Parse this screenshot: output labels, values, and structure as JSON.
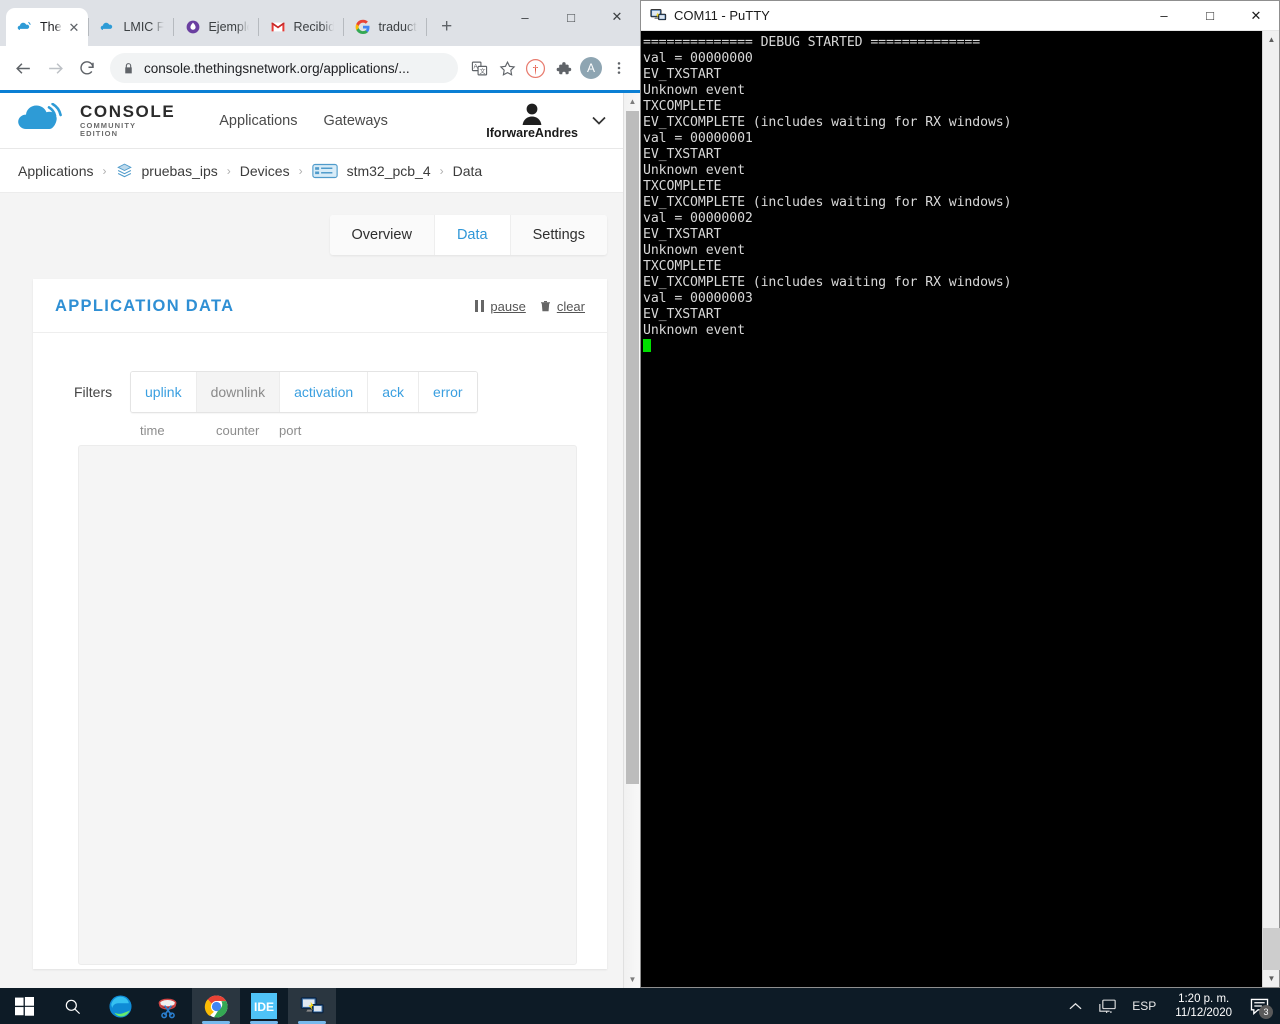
{
  "browser": {
    "tabs": [
      {
        "title": "The",
        "favicon": "ttn-cloud-icon",
        "active": true
      },
      {
        "title": "LMIC FO",
        "favicon": "ttn-cloud-icon",
        "active": false
      },
      {
        "title": "Ejemplo",
        "favicon": "firefox-droplet-icon",
        "active": false
      },
      {
        "title": "Recibid",
        "favicon": "gmail-icon",
        "active": false
      },
      {
        "title": "traduct",
        "favicon": "google-icon",
        "active": false
      }
    ],
    "new_tab_label": "+",
    "window_controls": {
      "minimize": "–",
      "maximize": "□",
      "close": "✕"
    },
    "toolbar": {
      "back_label": "←",
      "forward_label": "→",
      "reload_label": "⟳",
      "url": "console.thethingsnetwork.org/applications/...",
      "url_host": "console.thethingsnetwork.org",
      "url_path": "/applications/...",
      "lock_icon": "lock-icon",
      "translate_icon": "translate-icon",
      "bookmark_icon": "star-icon",
      "pdf_icon": "adobe-acrobat-icon",
      "extensions_icon": "puzzle-piece-icon",
      "profile_initial": "A",
      "menu_icon": "three-dots-icon"
    }
  },
  "ttn": {
    "logo": {
      "title": "CONSOLE",
      "subtitle_line1": "COMMUNITY",
      "subtitle_line2": "EDITION"
    },
    "nav": [
      {
        "label": "Applications"
      },
      {
        "label": "Gateways"
      }
    ],
    "user": {
      "name": "IforwareAndres",
      "chevron": "⌄"
    },
    "breadcrumb": [
      {
        "label": "Applications",
        "icon": null
      },
      {
        "label": "pruebas_ips",
        "icon": "layers-icon"
      },
      {
        "label": "Devices",
        "icon": null
      },
      {
        "label": "stm32_pcb_4",
        "icon": "device-board-icon"
      },
      {
        "label": "Data",
        "icon": null
      }
    ],
    "breadcrumb_separator": "›",
    "page_tabs": [
      {
        "label": "Overview",
        "active": false
      },
      {
        "label": "Data",
        "active": true
      },
      {
        "label": "Settings",
        "active": false
      }
    ],
    "card": {
      "title": "APPLICATION DATA",
      "actions": [
        {
          "label": "pause",
          "icon": "pause-icon"
        },
        {
          "label": "clear",
          "icon": "trash-icon"
        }
      ],
      "filters_label": "Filters",
      "filters": [
        {
          "label": "uplink",
          "enabled": true
        },
        {
          "label": "downlink",
          "enabled": false
        },
        {
          "label": "activation",
          "enabled": true
        },
        {
          "label": "ack",
          "enabled": true
        },
        {
          "label": "error",
          "enabled": true
        }
      ],
      "table_columns": [
        "time",
        "counter",
        "port"
      ],
      "table_rows": []
    }
  },
  "putty": {
    "title": "COM11 - PuTTY",
    "icon": "putty-terminal-icon",
    "window_controls": {
      "minimize": "–",
      "maximize": "□",
      "close": "✕"
    },
    "terminal_text": "============== DEBUG STARTED ==============\nval = 00000000\nEV_TXSTART\nUnknown event\nTXCOMPLETE\nEV_TXCOMPLETE (includes waiting for RX windows)\nval = 00000001\nEV_TXSTART\nUnknown event\nTXCOMPLETE\nEV_TXCOMPLETE (includes waiting for RX windows)\nval = 00000002\nEV_TXSTART\nUnknown event\nTXCOMPLETE\nEV_TXCOMPLETE (includes waiting for RX windows)\nval = 00000003\nEV_TXSTART\nUnknown event\n",
    "cursor_color": "#00e000",
    "text_color": "#d8d8d8",
    "background_color": "#000000"
  },
  "taskbar": {
    "start_label": "start-button",
    "items": [
      {
        "name": "search",
        "icon": "search-icon",
        "running": false,
        "active": false
      },
      {
        "name": "edge",
        "icon": "microsoft-edge-icon",
        "running": false,
        "active": false
      },
      {
        "name": "snipping-tool",
        "icon": "snipping-tool-icon",
        "running": false,
        "active": false
      },
      {
        "name": "chrome",
        "icon": "google-chrome-icon",
        "running": true,
        "active": true
      },
      {
        "name": "arduino-ide",
        "icon": "arduino-ide-icon",
        "running": true,
        "active": false
      },
      {
        "name": "putty",
        "icon": "putty-terminal-icon",
        "running": true,
        "active": true
      }
    ],
    "tray": {
      "overflow_icon": "chevron-up-icon",
      "network_icon": "network-monitor-icon",
      "language": "ESP",
      "time": "1:20 p. m.",
      "date": "11/12/2020",
      "notification_icon": "notification-icon",
      "notification_count": "3"
    }
  },
  "colors": {
    "ttn_blue": "#2f8fd4",
    "chrome_blue_rule": "#0b7fd4",
    "link_blue": "#3a9fe0",
    "taskbar_bg": "#0d1b26",
    "terminal_green": "#00e000"
  }
}
